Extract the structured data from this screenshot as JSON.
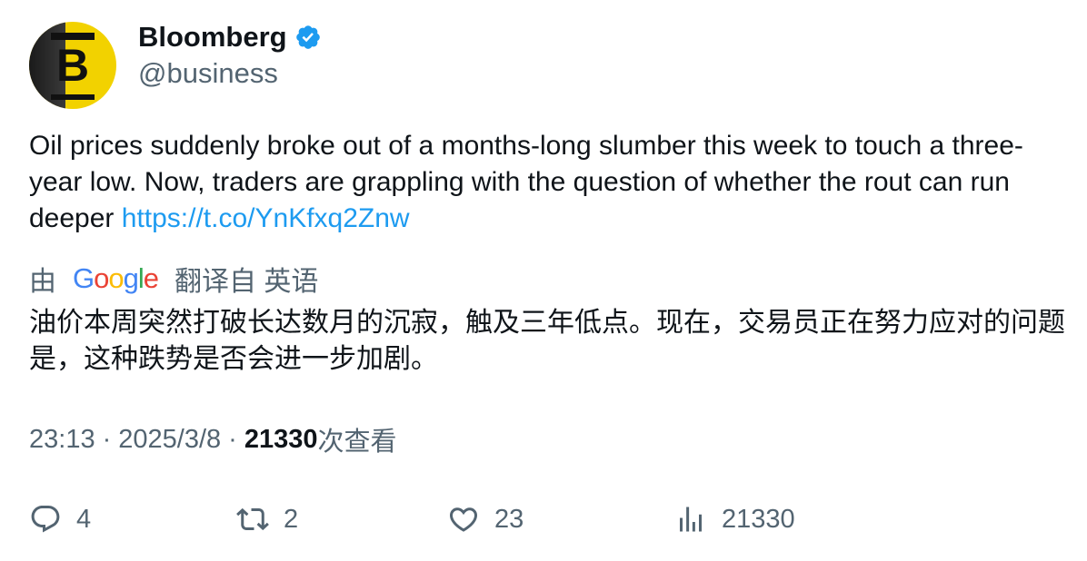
{
  "author": {
    "display_name": "Bloomberg",
    "handle": "@business",
    "avatar_letter": "B",
    "verified": true
  },
  "tweet": {
    "text": "Oil prices suddenly broke out of a months-long slumber this week to touch a three-year low. Now, traders are grappling with the question of whether the rout can run deeper",
    "link": "https://t.co/YnKfxq2Znw"
  },
  "translation": {
    "prefix": "由",
    "provider": "Google",
    "suffix": "翻译自 英语",
    "text": "油价本周突然打破长达数月的沉寂，触及三年低点。现在，交易员正在努力应对的问题是，这种跌势是否会进一步加剧。"
  },
  "meta": {
    "time": "23:13",
    "separator": "·",
    "date": "2025/3/8",
    "views_count": "21330",
    "views_label": "次查看"
  },
  "actions": {
    "replies": "4",
    "retweets": "2",
    "likes": "23",
    "views": "21330"
  },
  "colors": {
    "accent": "#1d9bf0",
    "secondary_text": "#536471",
    "avatar_bg": "#f2d200"
  }
}
